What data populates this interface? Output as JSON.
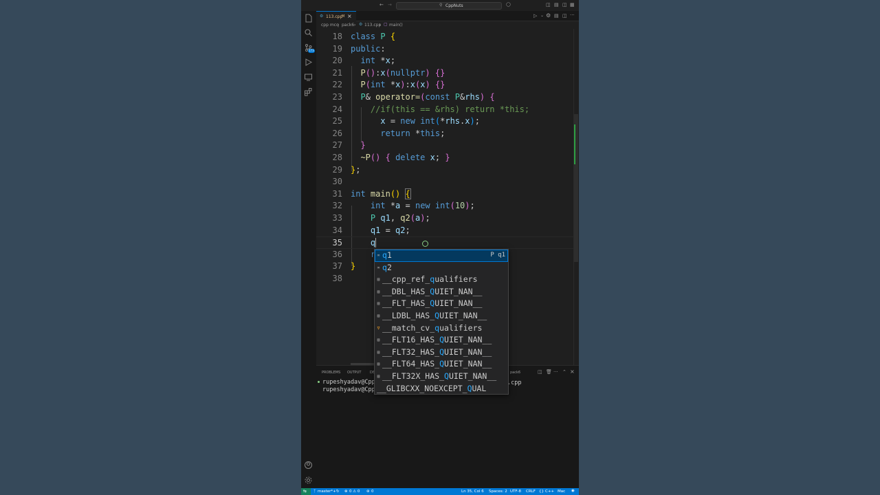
{
  "titlebar": {
    "search": "CppNuts"
  },
  "tab": {
    "filename": "113.cpp",
    "modified": "M"
  },
  "breadcrumb": {
    "folder1": "cpp mcq",
    "folder2": "pack6",
    "file": "113.cpp",
    "symbol": "main()"
  },
  "activity_badge": "173",
  "lines": [
    {
      "n": "18"
    },
    {
      "n": "19"
    },
    {
      "n": "20"
    },
    {
      "n": "21"
    },
    {
      "n": "22"
    },
    {
      "n": "23"
    },
    {
      "n": "24"
    },
    {
      "n": "25"
    },
    {
      "n": "26"
    },
    {
      "n": "27"
    },
    {
      "n": "28"
    },
    {
      "n": "29"
    },
    {
      "n": "30"
    },
    {
      "n": "31"
    },
    {
      "n": "32"
    },
    {
      "n": "33"
    },
    {
      "n": "34"
    },
    {
      "n": "35"
    },
    {
      "n": "36"
    },
    {
      "n": "37"
    },
    {
      "n": "38"
    }
  ],
  "suggest": {
    "detail": "P q1",
    "items": [
      {
        "pre": "",
        "hl": "q",
        "post": "1"
      },
      {
        "pre": "",
        "hl": "q",
        "post": "2"
      },
      {
        "pre": "__cpp_ref_",
        "hl": "q",
        "post": "ualifiers"
      },
      {
        "pre": "__DBL_HAS_",
        "hl": "Q",
        "post": "UIET_NAN__"
      },
      {
        "pre": "__FLT_HAS_",
        "hl": "Q",
        "post": "UIET_NAN__"
      },
      {
        "pre": "__LDBL_HAS_",
        "hl": "Q",
        "post": "UIET_NAN__"
      },
      {
        "pre": "__match_cv_",
        "hl": "q",
        "post": "ualifiers"
      },
      {
        "pre": "__FLT16_HAS_",
        "hl": "Q",
        "post": "UIET_NAN__"
      },
      {
        "pre": "__FLT32_HAS_",
        "hl": "Q",
        "post": "UIET_NAN__"
      },
      {
        "pre": "__FLT64_HAS_",
        "hl": "Q",
        "post": "UIET_NAN__"
      },
      {
        "pre": "__FLT32X_HAS_",
        "hl": "Q",
        "post": "UIET_NAN__"
      },
      {
        "pre": "__GLIBCXX_NOEXCEPT_",
        "hl": "Q",
        "post": "UAL"
      }
    ]
  },
  "panel": {
    "tabs": [
      "PROBLEMS",
      "OUTPUT",
      "DE"
    ],
    "terminal_label": "pack6",
    "term_lines": [
      "rupeshyadav@Cpp",
      "rupeshyadav@Cpp"
    ],
    "term_tail": ".cpp"
  },
  "status": {
    "branch": "master*+",
    "problems": "0 ⚠ 0",
    "ports": "0",
    "position": "Ln 35, Col 6",
    "spaces": "Spaces: 2",
    "encoding": "UTF-8",
    "eol": "CRLF",
    "language": "C++",
    "platform": "Mac"
  },
  "colors": {
    "accent": "#0078d4",
    "selection": "#04395e",
    "match": "#2aaaff"
  }
}
